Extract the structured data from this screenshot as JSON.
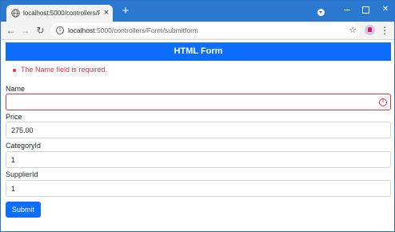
{
  "browser": {
    "tab_title": "localhost:5000/controllers/Form/submitform",
    "tab_close": "×",
    "new_tab": "+",
    "url_host": "localhost",
    "url_path": ":5000/controllers/Form/submitform",
    "back": "←",
    "forward": "→",
    "reload": "↻",
    "star": "☆",
    "menu": "⋮",
    "icons": {
      "favicon": "globe-icon",
      "site_info": "info-icon",
      "extension": "extension-icon",
      "window_menu": "chevron-down-icon"
    },
    "accent_color": "#2b78d0"
  },
  "page": {
    "header": "HTML Form",
    "header_color": "#0d6efd",
    "validation_errors": [
      "The Name field is required."
    ],
    "error_color": "#dc3545",
    "fields": [
      {
        "label": "Name",
        "value": "",
        "invalid": true
      },
      {
        "label": "Price",
        "value": "275.00"
      },
      {
        "label": "CategoryId",
        "value": "1"
      },
      {
        "label": "SupplierId",
        "value": "1"
      }
    ],
    "submit_label": "Submit"
  }
}
